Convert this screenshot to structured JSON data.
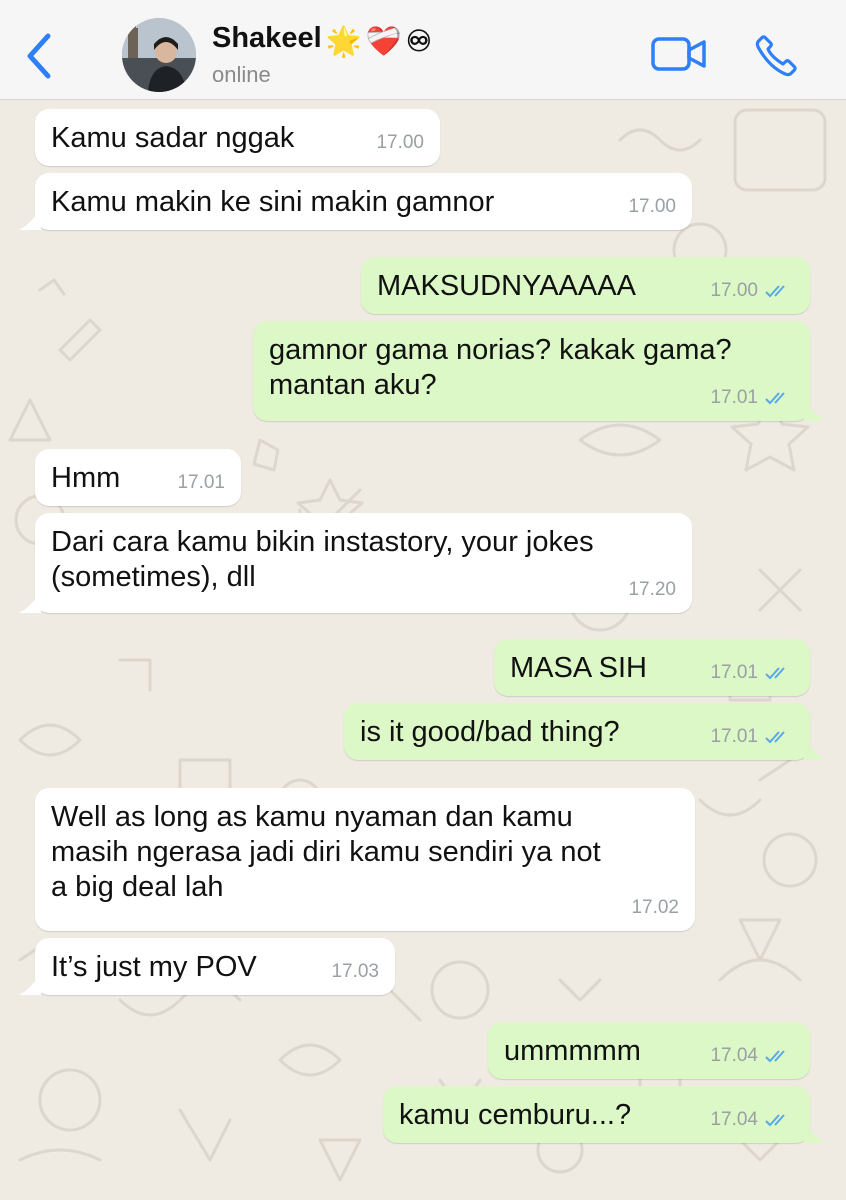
{
  "colors": {
    "accent": "#2f7ff6",
    "incoming_bubble": "#ffffff",
    "outgoing_bubble": "#dcf8c6",
    "read_ticks": "#5aa8e8",
    "chat_background": "#efeae2"
  },
  "header": {
    "back_icon": "chevron-left-icon",
    "contact_name": "Shakeel",
    "name_emojis": [
      "🌟",
      "❤️‍🩹",
      "♾"
    ],
    "status": "online",
    "video_icon": "video-camera-icon",
    "call_icon": "phone-icon"
  },
  "messages": [
    {
      "direction": "in",
      "text": [
        "Kamu sadar nggak"
      ],
      "time": "17.00",
      "read": false
    },
    {
      "direction": "in",
      "text": [
        "Kamu makin ke sini makin gamnor"
      ],
      "time": "17.00",
      "read": false
    },
    {
      "direction": "out",
      "text": [
        "MAKSUDNYAAAAA"
      ],
      "time": "17.00",
      "read": true
    },
    {
      "direction": "out",
      "text": [
        "gamnor gama norias? kakak gama?",
        "mantan aku?"
      ],
      "time": "17.01",
      "read": true
    },
    {
      "direction": "in",
      "text": [
        "Hmm"
      ],
      "time": "17.01",
      "read": false
    },
    {
      "direction": "in",
      "text": [
        "Dari cara kamu bikin instastory, your jokes",
        "(sometimes), dll"
      ],
      "time": "17.20",
      "read": false
    },
    {
      "direction": "out",
      "text": [
        "MASA SIH"
      ],
      "time": "17.01",
      "read": true
    },
    {
      "direction": "out",
      "text": [
        "is it good/bad thing?"
      ],
      "time": "17.01",
      "read": true
    },
    {
      "direction": "in",
      "text": [
        "Well as long as kamu nyaman dan kamu",
        "masih ngerasa jadi diri kamu sendiri ya not",
        "a big deal lah"
      ],
      "time": "17.02",
      "read": false
    },
    {
      "direction": "in",
      "text": [
        "It’s just my POV"
      ],
      "time": "17.03",
      "read": false
    },
    {
      "direction": "out",
      "text": [
        "ummmmm"
      ],
      "time": "17.04",
      "read": true
    },
    {
      "direction": "out",
      "text": [
        "kamu cemburu...?"
      ],
      "time": "17.04",
      "read": true
    }
  ]
}
